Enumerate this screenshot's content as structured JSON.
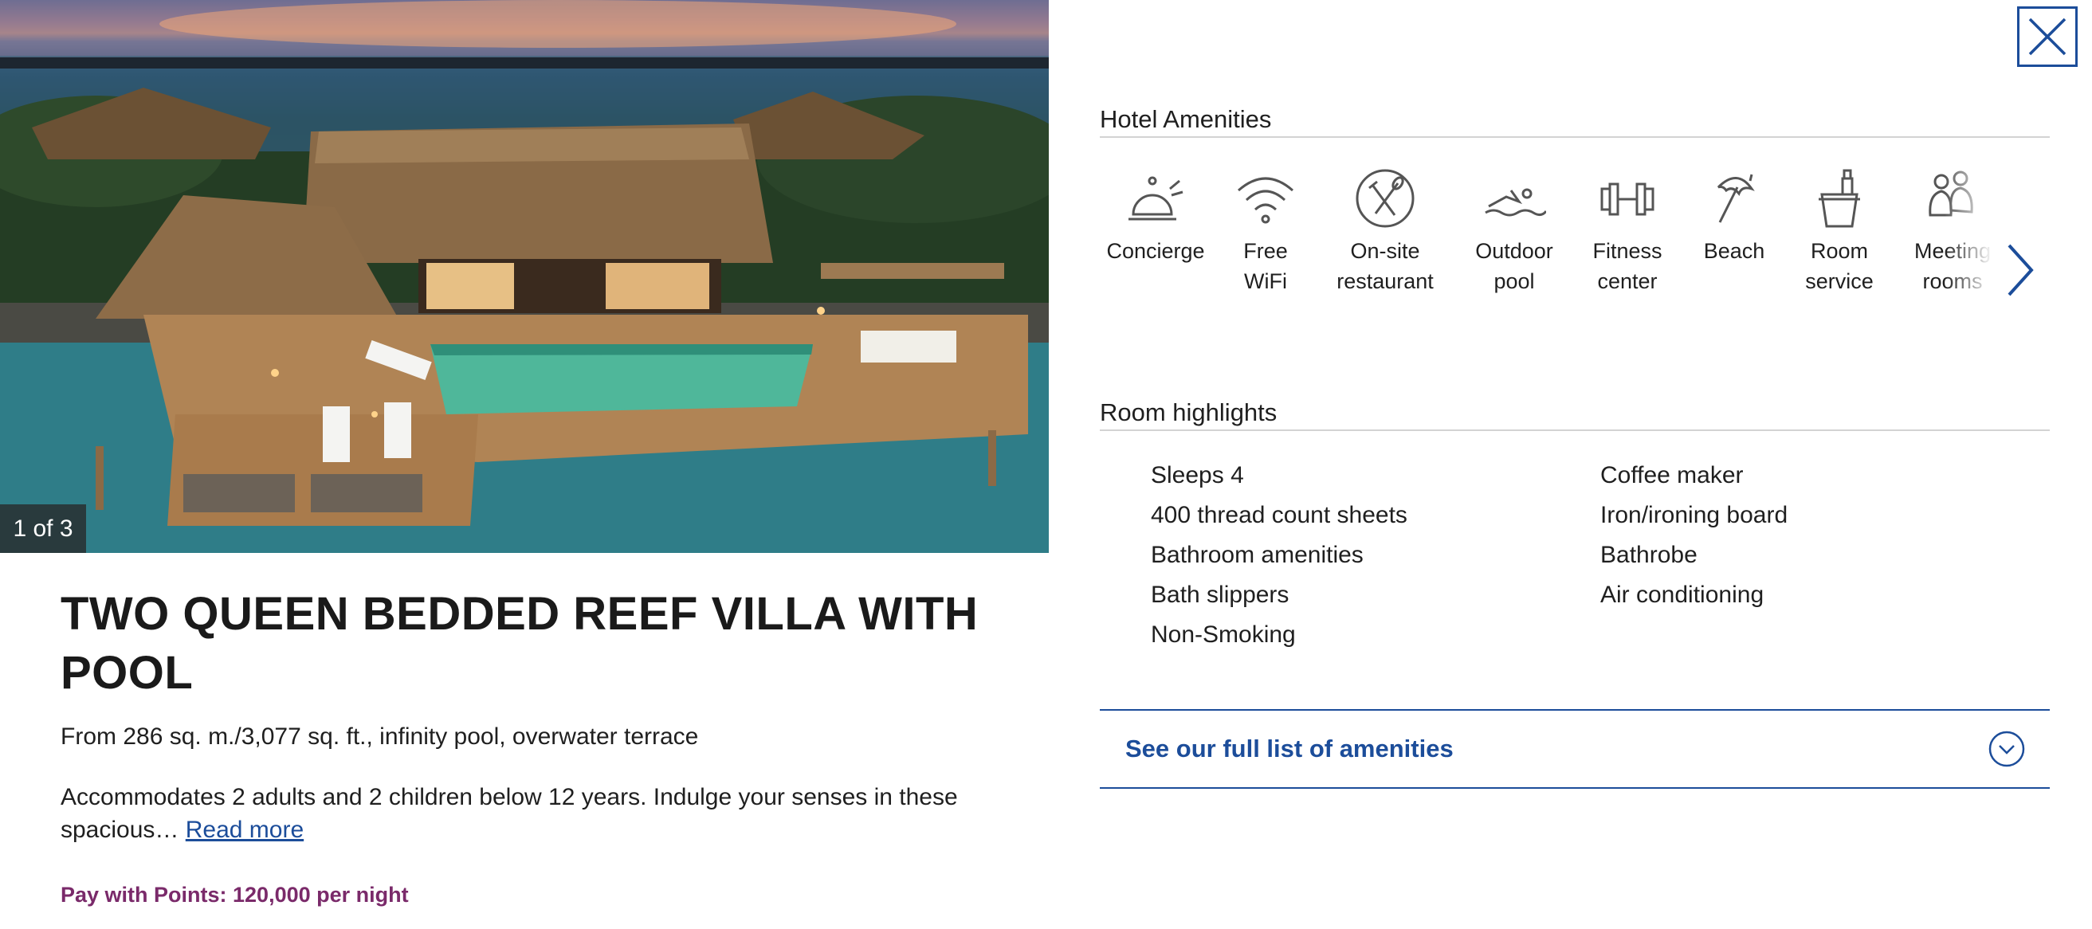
{
  "photo": {
    "counter": "1 of 3"
  },
  "room": {
    "title": "TWO QUEEN BEDDED REEF VILLA WITH POOL",
    "size_line": "From 286 sq. m./3,077 sq. ft., infinity pool, overwater terrace",
    "description": "Accommodates 2 adults and 2 children below 12 years. Indulge your senses in these spacious…",
    "read_more": "Read more",
    "points": "Pay with Points: 120,000 per night"
  },
  "amenities": {
    "title": "Hotel Amenities",
    "items": [
      {
        "label_line1": "Concierge",
        "label_line2": "",
        "icon": "concierge-bell-icon"
      },
      {
        "label_line1": "Free",
        "label_line2": "WiFi",
        "icon": "wifi-icon"
      },
      {
        "label_line1": "On-site",
        "label_line2": "restaurant",
        "icon": "restaurant-icon"
      },
      {
        "label_line1": "Outdoor",
        "label_line2": "pool",
        "icon": "swimmer-icon"
      },
      {
        "label_line1": "Fitness",
        "label_line2": "center",
        "icon": "dumbbell-icon"
      },
      {
        "label_line1": "Beach",
        "label_line2": "",
        "icon": "beach-umbrella-icon"
      },
      {
        "label_line1": "Room",
        "label_line2": "service",
        "icon": "ice-bucket-icon"
      },
      {
        "label_line1": "Meeting",
        "label_line2": "rooms",
        "icon": "meeting-people-icon"
      }
    ]
  },
  "highlights": {
    "title": "Room highlights",
    "col1": [
      "Sleeps 4",
      "400 thread count sheets",
      "Bathroom amenities",
      "Bath slippers",
      "Non-Smoking"
    ],
    "col2": [
      "Coffee maker",
      "Iron/ironing board",
      "Bathrobe",
      "Air conditioning"
    ]
  },
  "full_list": {
    "label": "See our full list of amenities"
  },
  "colors": {
    "accent": "#1c4d9a",
    "points": "#7a2a6a",
    "icon_stroke": "#555555"
  }
}
